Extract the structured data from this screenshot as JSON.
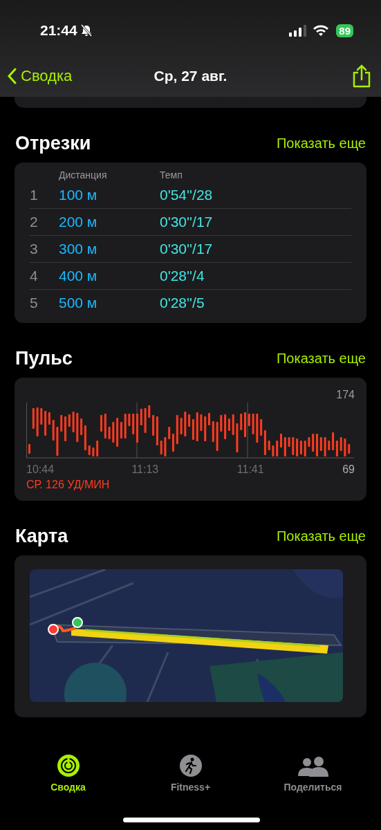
{
  "status_bar": {
    "time": "21:44",
    "battery": "89"
  },
  "nav": {
    "back": "Сводка",
    "title": "Ср, 27 авг."
  },
  "splits": {
    "title": "Отрезки",
    "more": "Показать еще",
    "columns": [
      "Дистанция",
      "Темп"
    ],
    "rows": [
      {
        "index": "1",
        "distance": "100 м",
        "pace": "0'54''/28"
      },
      {
        "index": "2",
        "distance": "200 м",
        "pace": "0'30''/17"
      },
      {
        "index": "3",
        "distance": "300 м",
        "pace": "0'30''/17"
      },
      {
        "index": "4",
        "distance": "400 м",
        "pace": "0'28''/4"
      },
      {
        "index": "5",
        "distance": "500 м",
        "pace": "0'28''/5"
      }
    ]
  },
  "heart_rate": {
    "title": "Пульс",
    "more": "Показать еще",
    "max": "174",
    "min": "69",
    "times": [
      "10:44",
      "11:13",
      "11:41"
    ],
    "average": "СР. 126 УД/МИН"
  },
  "map": {
    "title": "Карта",
    "more": "Показать еще"
  },
  "tab_bar": {
    "tabs": [
      {
        "label": "Сводка",
        "selected": true
      },
      {
        "label": "Fitness+",
        "selected": false
      },
      {
        "label": "Поделиться",
        "selected": false
      }
    ]
  }
}
